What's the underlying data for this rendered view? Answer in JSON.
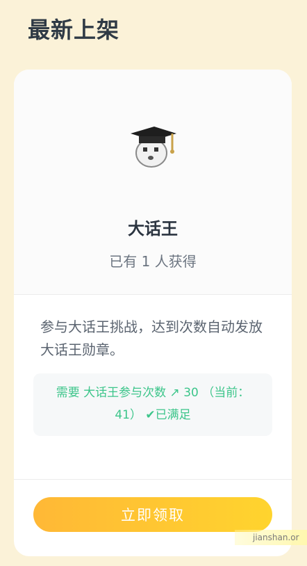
{
  "section": {
    "title": "最新上架"
  },
  "badge": {
    "icon": "graduate-cap-face-badge",
    "name": "大话王",
    "owners_text": "已有 1 人获得",
    "description": "参与大话王挑战，达到次数自动发放大话王勋章。",
    "requirement": {
      "prefix": "需要 大话王参与次数",
      "arrow": "↗",
      "target": "30",
      "current_text": "（当前：41）",
      "check": "✔",
      "status": "已满足"
    }
  },
  "actions": {
    "claim_label": "立即领取"
  },
  "watermark": {
    "text": "jianshan.or"
  },
  "colors": {
    "page_bg": "#fbf2d8",
    "accent_green": "#3cc58a",
    "button_start": "#ffb836",
    "button_end": "#ffd42e"
  }
}
